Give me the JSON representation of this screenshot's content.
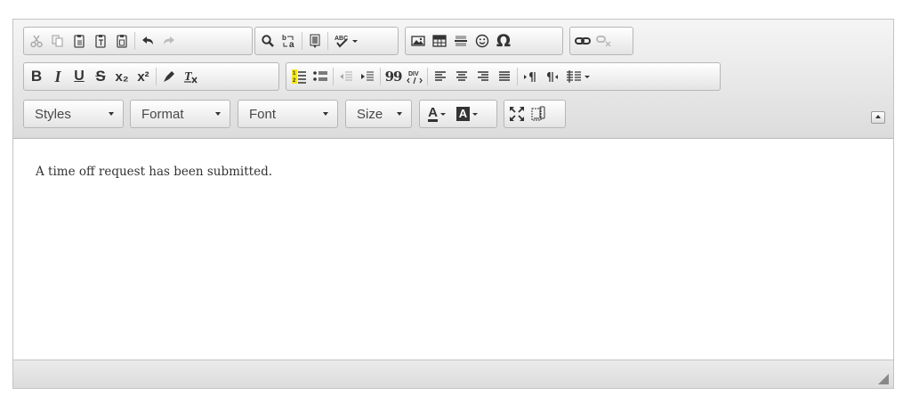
{
  "toolbar": {
    "bold": "B",
    "italic": "I",
    "underline": "U",
    "strike": "S",
    "subscript": "x₂",
    "superscript": "x²",
    "blockquote": "99",
    "div": "DIV",
    "special_char": "Ω",
    "styles": "Styles",
    "format": "Format",
    "font": "Font",
    "size": "Size",
    "text_color": "A",
    "bg_color": "A"
  },
  "content": {
    "text": "A time off request has been submitted."
  },
  "colors": {
    "toolbar_bg": "#dcdcdc",
    "border": "#c4c4c4",
    "highlight": "#f5e61d"
  }
}
